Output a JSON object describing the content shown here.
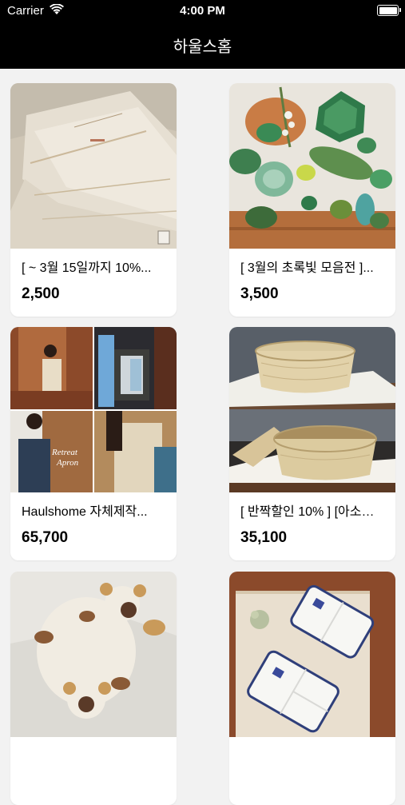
{
  "status_bar": {
    "carrier": "Carrier",
    "time": "4:00 PM"
  },
  "nav": {
    "title": "하울스홈"
  },
  "products": [
    {
      "title": "[ ~ 3월 15일까지 10%...",
      "price": "2,500",
      "image": "linen-napkins"
    },
    {
      "title": "[ 3월의 초록빛 모음전 ]...",
      "price": "3,500",
      "image": "green-ceramics"
    },
    {
      "title": "Haulshome 자체제작...",
      "price": "65,700",
      "image": "apron-collage",
      "image_text": [
        "Retreat",
        "Apron"
      ]
    },
    {
      "title": "[ 반짝할인 10% ] [아소…",
      "price": "35,100",
      "image": "bamboo-baskets"
    },
    {
      "title": "",
      "price": "",
      "image": "bear-rug"
    },
    {
      "title": "",
      "price": "",
      "image": "blue-white-plates"
    }
  ]
}
